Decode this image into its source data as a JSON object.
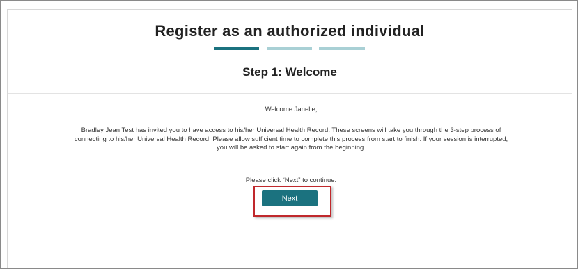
{
  "page": {
    "title": "Register as an authorized individual",
    "step_title": "Step 1: Welcome",
    "progress": {
      "current_step": 1,
      "total_steps": 3
    },
    "greeting": "Welcome Janelle,",
    "message": "Bradley Jean Test has invited you to have access to his/her Universal Health Record. These screens will take you through the 3-step process of connecting to his/her Universal Health Record. Please allow sufficient time to complete this process from start to finish. If your session is interrupted, you will be asked to start again from the beginning.",
    "continue_text": "Please click “Next” to continue.",
    "next_label": "Next"
  },
  "colors": {
    "accent": "#1b727f",
    "progress_inactive": "#a9d0d5",
    "highlight": "#c0282c"
  }
}
